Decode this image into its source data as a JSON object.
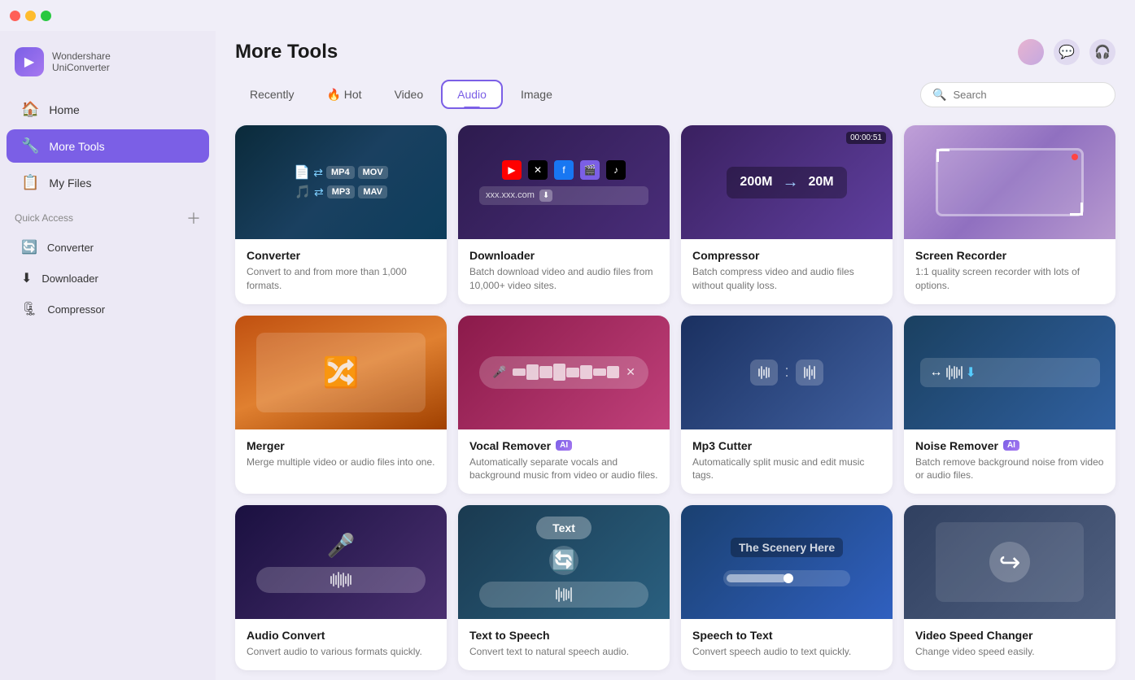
{
  "app": {
    "name": "Wondershare",
    "product": "UniConverter"
  },
  "titlebar": {
    "traffic": [
      "close",
      "minimize",
      "maximize"
    ]
  },
  "sidebar": {
    "nav_items": [
      {
        "id": "home",
        "label": "Home",
        "icon": "🏠",
        "active": false
      },
      {
        "id": "more-tools",
        "label": "More Tools",
        "icon": "🔧",
        "active": true
      }
    ],
    "my_files": {
      "label": "My Files",
      "icon": "📋"
    },
    "quick_access_label": "Quick Access",
    "quick_items": [
      {
        "id": "converter",
        "label": "Converter",
        "icon": "🔄"
      },
      {
        "id": "downloader",
        "label": "Downloader",
        "icon": "⬇"
      },
      {
        "id": "compressor",
        "label": "Compressor",
        "icon": "🗜"
      }
    ]
  },
  "header": {
    "title": "More Tools",
    "tabs": [
      {
        "id": "recently",
        "label": "Recently",
        "active": false
      },
      {
        "id": "hot",
        "label": "🔥 Hot",
        "active": false
      },
      {
        "id": "video",
        "label": "Video",
        "active": false
      },
      {
        "id": "audio",
        "label": "Audio",
        "active": true
      },
      {
        "id": "image",
        "label": "Image",
        "active": false
      }
    ],
    "search_placeholder": "Search"
  },
  "tools": [
    {
      "id": "converter",
      "name": "Converter",
      "desc": "Convert to and from more than 1,000 formats.",
      "thumb_type": "converter"
    },
    {
      "id": "downloader",
      "name": "Downloader",
      "desc": "Batch download video and audio files from 10,000+ video sites.",
      "thumb_type": "downloader"
    },
    {
      "id": "compressor",
      "name": "Compressor",
      "desc": "Batch compress video and audio files without quality loss.",
      "thumb_type": "compressor",
      "timestamp": "00:00:51",
      "size_from": "200M",
      "size_to": "20M"
    },
    {
      "id": "screen-recorder",
      "name": "Screen Recorder",
      "desc": "1:1 quality screen recorder with lots of options.",
      "thumb_type": "recorder"
    },
    {
      "id": "merger",
      "name": "Merger",
      "desc": "Merge multiple video or audio files into one.",
      "thumb_type": "merger"
    },
    {
      "id": "vocal-remover",
      "name": "Vocal Remover",
      "desc": "Automatically separate vocals and background music from video or audio files.",
      "thumb_type": "vocal",
      "ai": true
    },
    {
      "id": "mp3-cutter",
      "name": "Mp3 Cutter",
      "desc": "Automatically split music and edit music tags.",
      "thumb_type": "mp3"
    },
    {
      "id": "noise-remover",
      "name": "Noise Remover",
      "desc": "Batch remove background noise from video or audio files.",
      "thumb_type": "noise",
      "ai": true
    },
    {
      "id": "audio-convert",
      "name": "Audio Convert",
      "desc": "Convert audio to various formats quickly.",
      "thumb_type": "audio-convert"
    },
    {
      "id": "text-to-speech",
      "name": "Text to Speech",
      "desc": "Convert text to natural speech audio.",
      "thumb_type": "speech",
      "text_label": "Text"
    },
    {
      "id": "speech-to-text",
      "name": "Speech to Text",
      "desc": "Convert speech audio to text quickly.",
      "thumb_type": "text-audio"
    },
    {
      "id": "video-speed",
      "name": "Video Speed Changer",
      "desc": "Change video speed easily.",
      "thumb_type": "speed"
    }
  ]
}
